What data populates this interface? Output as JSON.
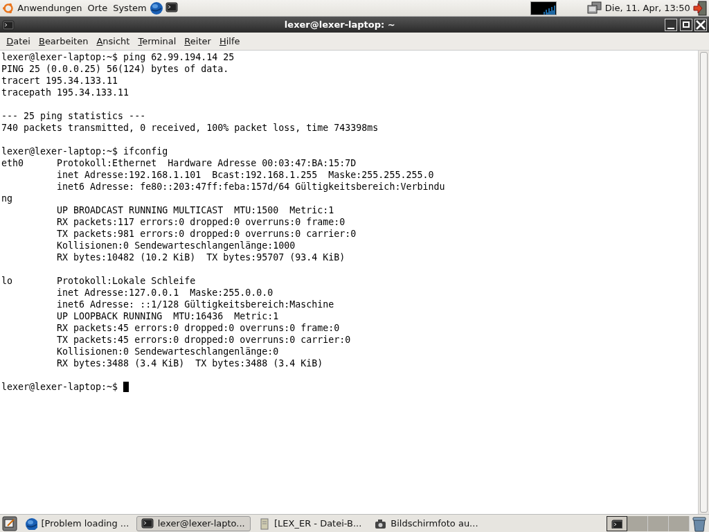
{
  "top_panel": {
    "menus": [
      "Anwendungen",
      "Orte",
      "System"
    ],
    "clock": "Die, 11. Apr, 13:50"
  },
  "window": {
    "title": "lexer@lexer-laptop: ~",
    "menus": [
      "Datei",
      "Bearbeiten",
      "Ansicht",
      "Terminal",
      "Reiter",
      "Hilfe"
    ]
  },
  "terminal": {
    "blocks": [
      [
        "lexer@lexer-laptop:~$ ping 62.99.194.14 25",
        "PING 25 (0.0.0.25) 56(124) bytes of data.",
        "tracert 195.34.133.11",
        "tracepath 195.34.133.11"
      ],
      [
        "--- 25 ping statistics ---",
        "740 packets transmitted, 0 received, 100% packet loss, time 743398ms"
      ],
      [
        "lexer@lexer-laptop:~$ ifconfig",
        "eth0      Protokoll:Ethernet  Hardware Adresse 00:03:47:BA:15:7D",
        "          inet Adresse:192.168.1.101  Bcast:192.168.1.255  Maske:255.255.255.0",
        "          inet6 Adresse: fe80::203:47ff:feba:157d/64 Gültigkeitsbereich:Verbindu",
        "ng",
        "          UP BROADCAST RUNNING MULTICAST  MTU:1500  Metric:1",
        "          RX packets:117 errors:0 dropped:0 overruns:0 frame:0",
        "          TX packets:981 errors:0 dropped:0 overruns:0 carrier:0",
        "          Kollisionen:0 Sendewarteschlangenlänge:1000",
        "          RX bytes:10482 (10.2 KiB)  TX bytes:95707 (93.4 KiB)"
      ],
      [
        "lo        Protokoll:Lokale Schleife",
        "          inet Adresse:127.0.0.1  Maske:255.0.0.0",
        "          inet6 Adresse: ::1/128 Gültigkeitsbereich:Maschine",
        "          UP LOOPBACK RUNNING  MTU:16436  Metric:1",
        "          RX packets:45 errors:0 dropped:0 overruns:0 frame:0",
        "          TX packets:45 errors:0 dropped:0 overruns:0 carrier:0",
        "          Kollisionen:0 Sendewarteschlangenlänge:0",
        "          RX bytes:3488 (3.4 KiB)  TX bytes:3488 (3.4 KiB)"
      ]
    ],
    "prompt": "lexer@lexer-laptop:~$"
  },
  "taskbar": {
    "tasks": [
      {
        "label": "[Problem loading ...",
        "kind": "browser",
        "selected": false
      },
      {
        "label": "lexer@lexer-lapto...",
        "kind": "terminal",
        "selected": true
      },
      {
        "label": "[LEX_ER - Datei-B...",
        "kind": "files",
        "selected": false
      },
      {
        "label": "Bildschirmfoto au...",
        "kind": "camera",
        "selected": false
      }
    ],
    "workspaces": [
      {
        "selected": true
      },
      {
        "selected": false
      },
      {
        "selected": false
      },
      {
        "selected": false
      }
    ]
  }
}
